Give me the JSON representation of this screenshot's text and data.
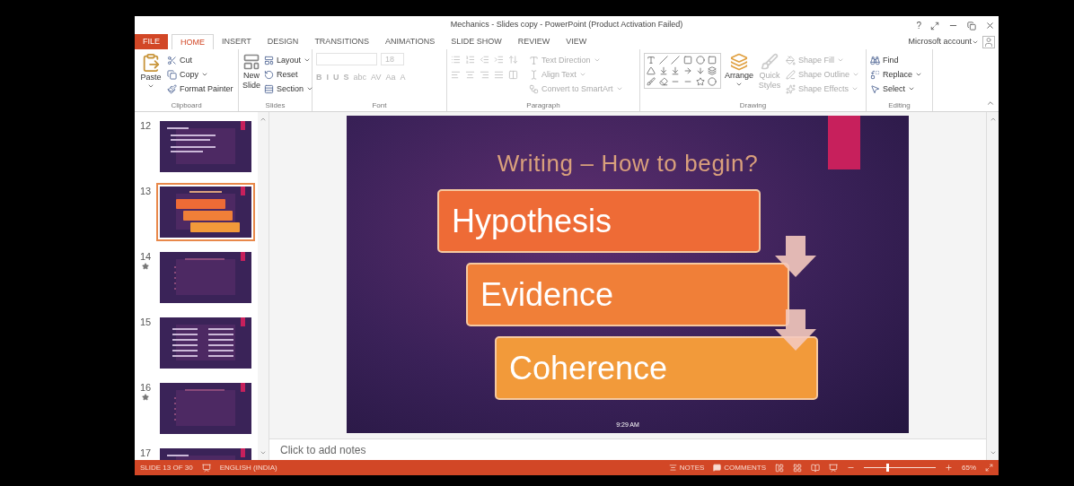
{
  "window": {
    "title": "Mechanics - Slides copy - PowerPoint (Product Activation Failed)",
    "help": "?",
    "account": "Microsoft account"
  },
  "tabs": [
    {
      "label": "FILE",
      "kind": "file",
      "selected": false
    },
    {
      "label": "HOME",
      "kind": "tab",
      "selected": true
    },
    {
      "label": "INSERT",
      "kind": "tab",
      "selected": false
    },
    {
      "label": "DESIGN",
      "kind": "tab",
      "selected": false
    },
    {
      "label": "TRANSITIONS",
      "kind": "tab",
      "selected": false
    },
    {
      "label": "ANIMATIONS",
      "kind": "tab",
      "selected": false
    },
    {
      "label": "SLIDE SHOW",
      "kind": "tab",
      "selected": false
    },
    {
      "label": "REVIEW",
      "kind": "tab",
      "selected": false
    },
    {
      "label": "VIEW",
      "kind": "tab",
      "selected": false
    }
  ],
  "ribbon": {
    "clipboard": {
      "label": "Clipboard",
      "paste": "Paste",
      "items": [
        {
          "label": "Cut",
          "dropdown": false
        },
        {
          "label": "Copy",
          "dropdown": true
        },
        {
          "label": "Format Painter",
          "dropdown": false
        }
      ]
    },
    "slides": {
      "label": "Slides",
      "new_slide": "New Slide",
      "items": [
        {
          "label": "Layout",
          "dropdown": true
        },
        {
          "label": "Reset",
          "dropdown": false
        },
        {
          "label": "Section",
          "dropdown": true
        }
      ]
    },
    "font": {
      "label": "Font",
      "size": "18",
      "disabled": true,
      "buttons": [
        "B",
        "I",
        "U",
        "S",
        "abc",
        "AV",
        "Aa",
        "A"
      ]
    },
    "paragraph": {
      "label": "Paragraph",
      "disabled": true,
      "items": [
        {
          "label": "Text Direction",
          "dropdown": true
        },
        {
          "label": "Align Text",
          "dropdown": true
        },
        {
          "label": "Convert to SmartArt",
          "dropdown": true
        }
      ]
    },
    "drawing": {
      "label": "Drawing",
      "arrange": "Arrange",
      "quick_styles": {
        "label": "Quick Styles",
        "disabled": true
      },
      "items": [
        {
          "label": "Shape Fill",
          "dropdown": true,
          "disabled": true
        },
        {
          "label": "Shape Outline",
          "dropdown": true,
          "disabled": true
        },
        {
          "label": "Shape Effects",
          "dropdown": true,
          "disabled": true
        }
      ]
    },
    "editing": {
      "label": "Editing",
      "items": [
        {
          "label": "Find",
          "dropdown": false
        },
        {
          "label": "Replace",
          "dropdown": true
        },
        {
          "label": "Select",
          "dropdown": true
        }
      ]
    }
  },
  "thumbnails": [
    {
      "number": "12",
      "kind": "text",
      "starred": false,
      "selected": false
    },
    {
      "number": "13",
      "kind": "diagram",
      "starred": false,
      "selected": true
    },
    {
      "number": "14",
      "kind": "bullets",
      "starred": true,
      "selected": false
    },
    {
      "number": "15",
      "kind": "columns",
      "starred": false,
      "selected": false
    },
    {
      "number": "16",
      "kind": "bullets",
      "starred": true,
      "selected": false
    },
    {
      "number": "17",
      "kind": "text",
      "selected": false
    }
  ],
  "slide": {
    "title": "Writing – How to begin?",
    "boxes": [
      {
        "label": "Hypothesis",
        "color": "#ee6b36"
      },
      {
        "label": "Evidence",
        "color": "#f07f38"
      },
      {
        "label": "Coherence",
        "color": "#f29a3a"
      }
    ],
    "time": "9:29 AM"
  },
  "notes": {
    "placeholder": "Click to add notes"
  },
  "status_bar": {
    "slide": "SLIDE 13 OF 30",
    "language": "ENGLISH (INDIA)",
    "notes": "NOTES",
    "comments": "COMMENTS",
    "zoom": {
      "level": 0.33,
      "reading": "65%"
    }
  }
}
